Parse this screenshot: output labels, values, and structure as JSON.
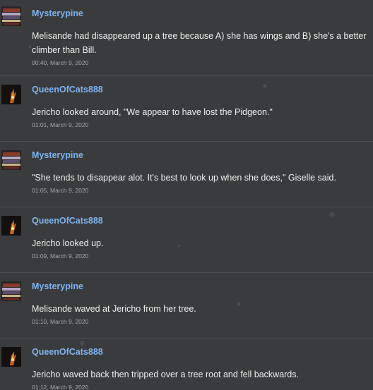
{
  "posts": [
    {
      "username": "Mysterypine",
      "avatar": "mysterypine-avatar",
      "message": "Melisande had disappeared up a tree because A) she has wings and B) she's a better climber than Bill.",
      "timestamp": "00:40, March 9, 2020"
    },
    {
      "username": "QueenOfCats888",
      "avatar": "queenofcats-avatar",
      "message": "Jericho looked around, \"We appear to have lost the Pidgeon.\"",
      "timestamp": "01:01, March 9, 2020"
    },
    {
      "username": "Mysterypine",
      "avatar": "mysterypine-avatar",
      "message": "\"She tends to disappear alot. It's best to look up when she does,\" Giselle said.",
      "timestamp": "01:05, March 9, 2020"
    },
    {
      "username": "QueenOfCats888",
      "avatar": "queenofcats-avatar",
      "message": "Jericho looked up.",
      "timestamp": "01:09, March 9, 2020"
    },
    {
      "username": "Mysterypine",
      "avatar": "mysterypine-avatar",
      "message": "Melisande waved at Jericho from her tree.",
      "timestamp": "01:10, March 9, 2020"
    },
    {
      "username": "QueenOfCats888",
      "avatar": "queenofcats-avatar",
      "message": "Jericho waved back then tripped over a tree root and fell backwards.",
      "timestamp": "01:12, March 9, 2020"
    }
  ],
  "colors": {
    "background": "#3a3b3c",
    "username": "#7cb3f0",
    "message": "#eeeeee",
    "timestamp": "#a7a8a9",
    "divider": "#4c4d4e"
  }
}
